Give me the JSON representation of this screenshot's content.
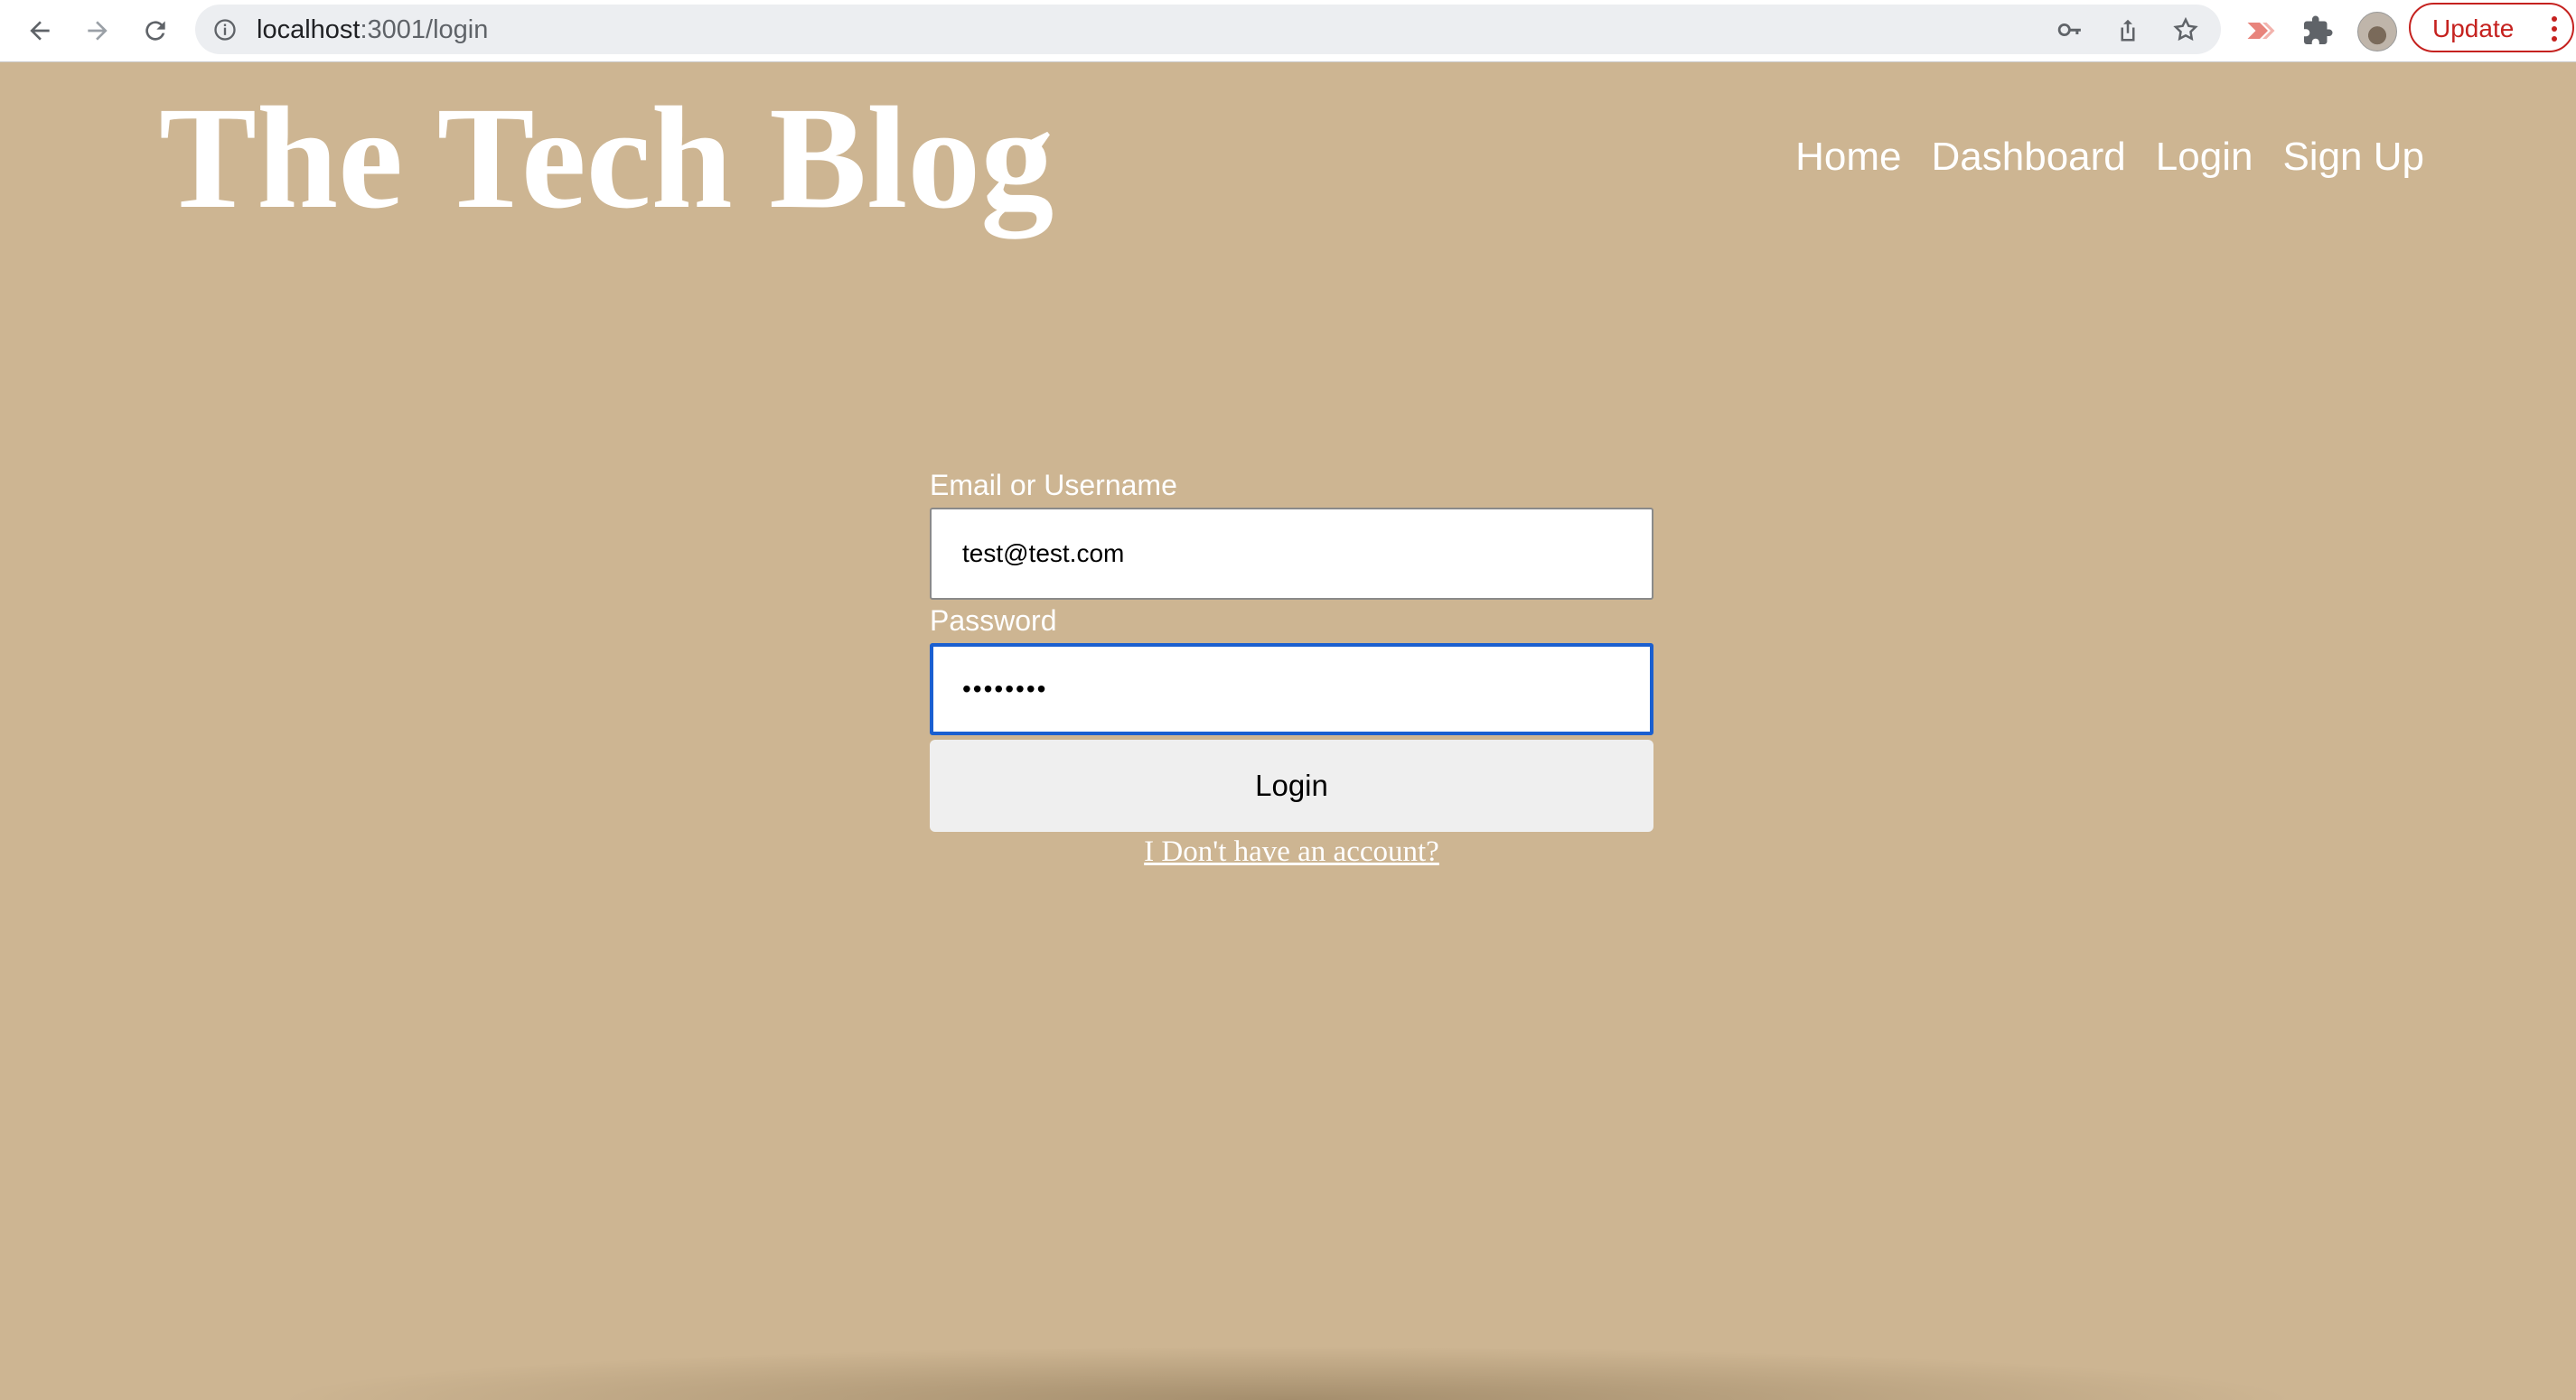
{
  "browser": {
    "url_host": "localhost",
    "url_path": ":3001/login",
    "update_label": "Update",
    "icons": [
      "back-icon",
      "forward-icon",
      "reload-icon",
      "info-icon",
      "key-icon",
      "share-icon",
      "star-icon",
      "media-icon",
      "extensions-icon",
      "profile-avatar",
      "menu-dots-icon"
    ]
  },
  "site": {
    "title": "The Tech Blog",
    "nav": [
      "Home",
      "Dashboard",
      "Login",
      "Sign Up"
    ]
  },
  "login_form": {
    "email_label": "Email or Username",
    "email_value": "test@test.com",
    "password_label": "Password",
    "password_value": "••••••••",
    "submit_label": "Login",
    "signup_link": "I Don't have an account?"
  },
  "colors": {
    "page_background": "#cdb592",
    "focus_ring": "#1a5fd0",
    "update_accent": "#c5221f"
  }
}
